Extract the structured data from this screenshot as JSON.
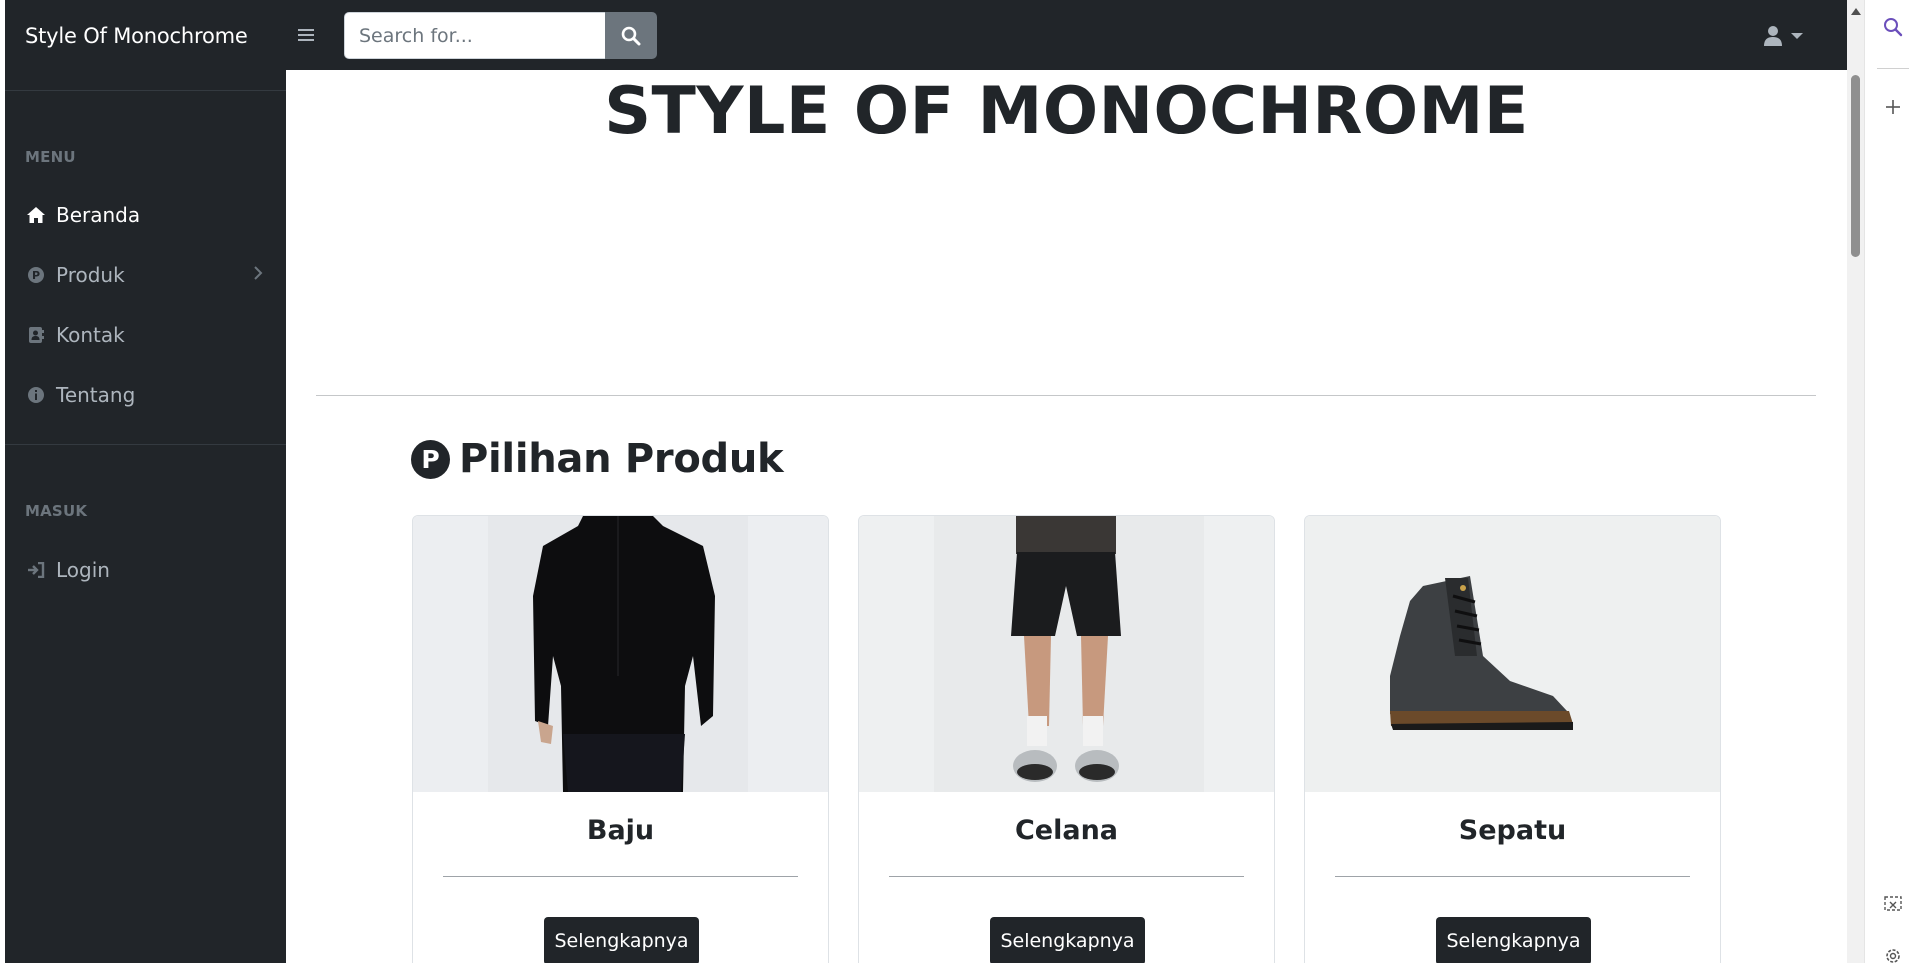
{
  "navbar": {
    "brand": "Style Of Monochrome",
    "search_placeholder": "Search for...",
    "search_icon": "search-icon",
    "toggle_icon": "hamburger-icon",
    "user_icon": "user-icon"
  },
  "sidebar": {
    "headings": [
      "MENU",
      "MASUK"
    ],
    "items": [
      {
        "label": "Beranda",
        "icon": "home-icon",
        "active": true
      },
      {
        "label": "Produk",
        "icon": "p-circle-icon",
        "has_submenu": true
      },
      {
        "label": "Kontak",
        "icon": "address-book-icon"
      },
      {
        "label": "Tentang",
        "icon": "info-circle-icon"
      }
    ],
    "login": {
      "label": "Login",
      "icon": "sign-in-icon"
    }
  },
  "main": {
    "hero_title": "STYLE OF MONOCHROME",
    "section_icon_letter": "P",
    "section_title": "Pilihan Produk",
    "products": [
      {
        "name": "Baju",
        "button": "Selengkapnya",
        "image": "black-shirt-photo"
      },
      {
        "name": "Celana",
        "button": "Selengkapnya",
        "image": "black-shorts-photo"
      },
      {
        "name": "Sepatu",
        "button": "Selengkapnya",
        "image": "black-boot-photo"
      }
    ]
  },
  "colors": {
    "dark": "#212529",
    "muted": "#adb5bd",
    "search_button": "#6c757d"
  }
}
